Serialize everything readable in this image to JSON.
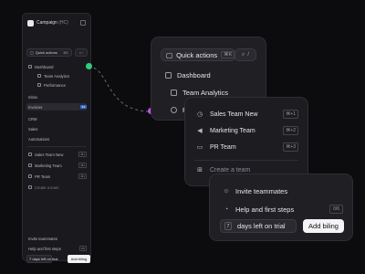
{
  "sidebar": {
    "title": "Campaign",
    "title_suffix": "(HC)",
    "quick_actions": "Quick actions",
    "quick_kbd": "⌘K",
    "search_kbd": "/",
    "items": {
      "dashboard": "Dashboard",
      "team_analytics": "Team Analytics",
      "performance": "Performance",
      "inbox": "Inbox",
      "invoices": "Invoices",
      "invoices_badge": "12",
      "crm": "CRM",
      "sales": "Sales",
      "automations": "Automations",
      "sales_team_new": "Sales Team New",
      "marketing_team": "Marketing Team",
      "pr_team": "PR Team",
      "create_team": "Create a team",
      "invite": "Invite teammates",
      "help": "Help and first steps",
      "help_kbd": "0/6"
    },
    "kbd": {
      "k1": "⌘1",
      "k2": "⌘2",
      "k3": "⌘3"
    },
    "trial_text": "days left on trial",
    "trial_days": "7",
    "billing_button": "Add biling"
  },
  "panel1": {
    "quick_actions": "Quick actions",
    "quick_kbd": "⌘K",
    "search_kbd": "/",
    "dashboard": "Dashboard",
    "team_analytics": "Team Analytics",
    "performance_partial": "Pe"
  },
  "panel2": {
    "sales_team_new": "Sales Team New",
    "marketing_team": "Marketing Team",
    "pr_team": "PR Team",
    "k1": "⌘+1",
    "k2": "⌘+2",
    "k3": "⌘+3",
    "create_team": "Create a team"
  },
  "panel3": {
    "invite": "Invite teammates",
    "help": "Help and first steps",
    "help_kbd": "0/6",
    "trial_days": "7",
    "trial_text": "days left on trial",
    "billing_button": "Add biling"
  },
  "colors": {
    "green_dot": "#2fce7e",
    "purple_dot": "#c64cf2",
    "badge_blue": "#2f6fd6"
  }
}
